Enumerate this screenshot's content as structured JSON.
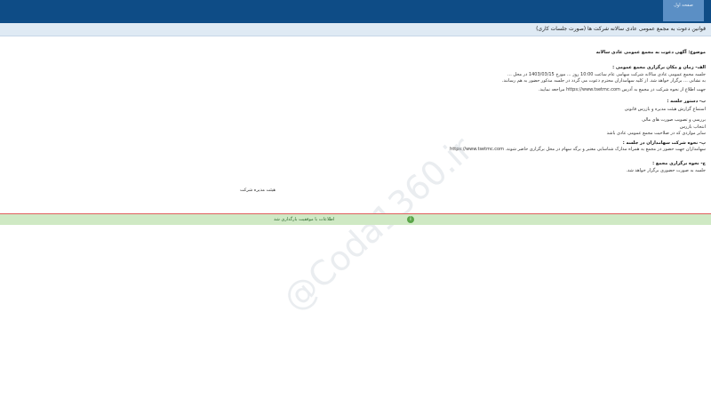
{
  "header": {
    "user_tab_label": "صفحه اول"
  },
  "titlebar": {
    "title": "قوانین دعوت به مجمع عمومی عادی سالانه شرکت ها (صورت جلسات کاری)"
  },
  "content": {
    "subject": "موضوع: آگهی دعوت به مجمع عمومی عادی سالانه",
    "meeting_time_label": "الف- زمان و مکان برگزاری مجمع عمومی :",
    "meeting_time_text": "جلسه مجمع عمومی عادی سالانه شرکت سهامی عام ساعت 10:00 روز ... مورخ 1403/03/15 در محل ...",
    "meeting_location_text": "به نشانی ... برگزار خواهد شد. از کلیه سهامداران محترم دعوت می گردد در جلسه مذکور حضور به هم رسانند.",
    "registration_link_text": "جهت اطلاع از نحوه شرکت در مجمع به آدرس https://www.tsetmc.com مراجعه نمایید.",
    "agenda_label": "ب- دستور جلسه :",
    "agenda_items": [
      "استماع گزارش هیئت مدیره و بازرس قانونی",
      "بررسی و تصویب صورت های مالی",
      "انتخاب بازرس",
      "سایر مواردی که در صلاحیت مجمع عمومی عادی باشد"
    ],
    "participation_label": "پ- نحوه شرکت سهامداران در جلسه :",
    "participation_text": "سهامداران جهت حضور در مجمع به همراه مدارک شناسایی معتبر و برگه سهام در محل برگزاری حاضر شوند. https://www.tsetmc.com",
    "holding_label": "ج- نحوه برگزاری مجمع :",
    "holding_text": "جلسه به صورت حضوری برگزار خواهد شد.",
    "signature": "هیئت مدیره شرکت"
  },
  "status": {
    "message": "اطلاعات با موفقیت بارگذاری شد"
  },
  "watermark": "@Coda1360.ir",
  "colors": {
    "header": "#0e4c86",
    "user_tab": "#5b8fc5",
    "titlebar": "#dfeaf4",
    "status_bg": "#cfe9c4",
    "divider": "#e0605e"
  }
}
